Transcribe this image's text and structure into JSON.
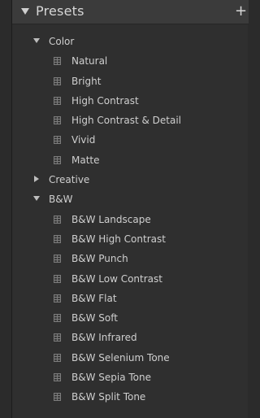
{
  "panel": {
    "title": "Presets",
    "add_icon": "plus-icon",
    "expanded_icon": "triangle-down-icon",
    "collapsed_icon": "triangle-right-icon",
    "preset_icon": "preset-list-icon",
    "colors": {
      "background": "#2f2f2f",
      "header": "#3b3b3b",
      "text": "#cfcfcf"
    }
  },
  "folders": [
    {
      "name": "Color",
      "expanded": true,
      "items": [
        "Natural",
        "Bright",
        "High Contrast",
        "High Contrast & Detail",
        "Vivid",
        "Matte"
      ]
    },
    {
      "name": "Creative",
      "expanded": false,
      "items": []
    },
    {
      "name": "B&W",
      "expanded": true,
      "items": [
        "B&W Landscape",
        "B&W High Contrast",
        "B&W Punch",
        "B&W Low Contrast",
        "B&W Flat",
        "B&W Soft",
        "B&W Infrared",
        "B&W Selenium Tone",
        "B&W Sepia Tone",
        "B&W Split Tone"
      ]
    }
  ]
}
